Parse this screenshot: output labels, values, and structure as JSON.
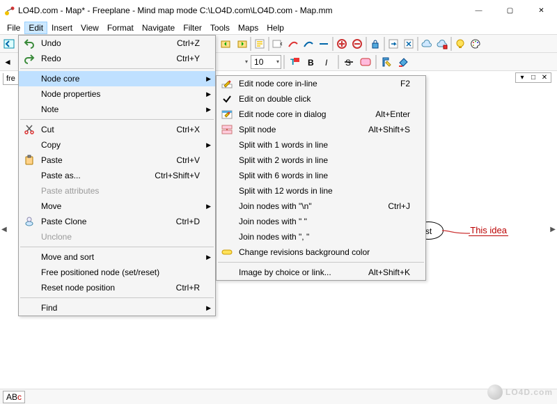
{
  "window": {
    "title": "LO4D.com - Map* - Freeplane - Mind map mode C:\\LO4D.com\\LO4D.com - Map.mm",
    "controls": {
      "min": "—",
      "max": "▢",
      "close": "✕"
    }
  },
  "menubar": [
    "File",
    "Edit",
    "Insert",
    "View",
    "Format",
    "Navigate",
    "Filter",
    "Tools",
    "Maps",
    "Help"
  ],
  "menubar_open_index": 1,
  "format": {
    "font_size": "10"
  },
  "tabs": {
    "partial_label": "fre"
  },
  "edit_menu": {
    "sections": [
      [
        {
          "icon": "undo-icon",
          "label": "Undo",
          "accel": "Ctrl+Z"
        },
        {
          "icon": "redo-icon",
          "label": "Redo",
          "accel": "Ctrl+Y"
        }
      ],
      [
        {
          "icon": "",
          "label": "Node core",
          "submenu": true,
          "highlight": true
        },
        {
          "icon": "",
          "label": "Node properties",
          "submenu": true
        },
        {
          "icon": "",
          "label": "Note",
          "submenu": true
        }
      ],
      [
        {
          "icon": "cut-icon",
          "label": "Cut",
          "accel": "Ctrl+X"
        },
        {
          "icon": "",
          "label": "Copy",
          "submenu": true
        },
        {
          "icon": "paste-icon",
          "label": "Paste",
          "accel": "Ctrl+V"
        },
        {
          "icon": "",
          "label": "Paste as...",
          "accel": "Ctrl+Shift+V"
        },
        {
          "icon": "",
          "label": "Paste attributes",
          "disabled": true
        },
        {
          "icon": "",
          "label": "Move",
          "submenu": true
        },
        {
          "icon": "clone-icon",
          "label": "Paste Clone",
          "accel": "Ctrl+D"
        },
        {
          "icon": "",
          "label": "Unclone",
          "disabled": true
        }
      ],
      [
        {
          "icon": "",
          "label": "Move and sort",
          "submenu": true
        },
        {
          "icon": "",
          "label": "Free positioned node (set/reset)"
        },
        {
          "icon": "",
          "label": "Reset node position",
          "accel": "Ctrl+R"
        }
      ],
      [
        {
          "icon": "",
          "label": "Find",
          "submenu": true
        }
      ]
    ]
  },
  "submenu": {
    "sections": [
      [
        {
          "icon": "edit-inline-icon",
          "label": "Edit node core in-line",
          "accel": "F2"
        },
        {
          "icon": "check-icon",
          "label": "Edit on double click",
          "checked": true
        },
        {
          "icon": "edit-dialog-icon",
          "label": "Edit node core in dialog",
          "accel": "Alt+Enter"
        },
        {
          "icon": "split-icon",
          "label": "Split node",
          "accel": "Alt+Shift+S"
        },
        {
          "icon": "",
          "label": "Split with 1 words in line"
        },
        {
          "icon": "",
          "label": "Split with 2 words in line"
        },
        {
          "icon": "",
          "label": "Split with 6 words in line"
        },
        {
          "icon": "",
          "label": "Split with 12 words in line"
        },
        {
          "icon": "",
          "label": "Join nodes with \"\\n\"",
          "accel": "Ctrl+J"
        },
        {
          "icon": "",
          "label": "Join nodes with \" \""
        },
        {
          "icon": "",
          "label": "Join nodes with \", \""
        },
        {
          "icon": "color-icon",
          "label": "Change revisions background color"
        }
      ],
      [
        {
          "icon": "",
          "label": "Image by choice or link...",
          "accel": "Alt+Shift+K"
        }
      ]
    ]
  },
  "mindmap": {
    "root_partial": "st",
    "child": "This idea"
  },
  "statusbar": {
    "abc_label_A": "A",
    "abc_label_B": "B",
    "abc_label_C": "c"
  },
  "watermark": "LO4D.com"
}
